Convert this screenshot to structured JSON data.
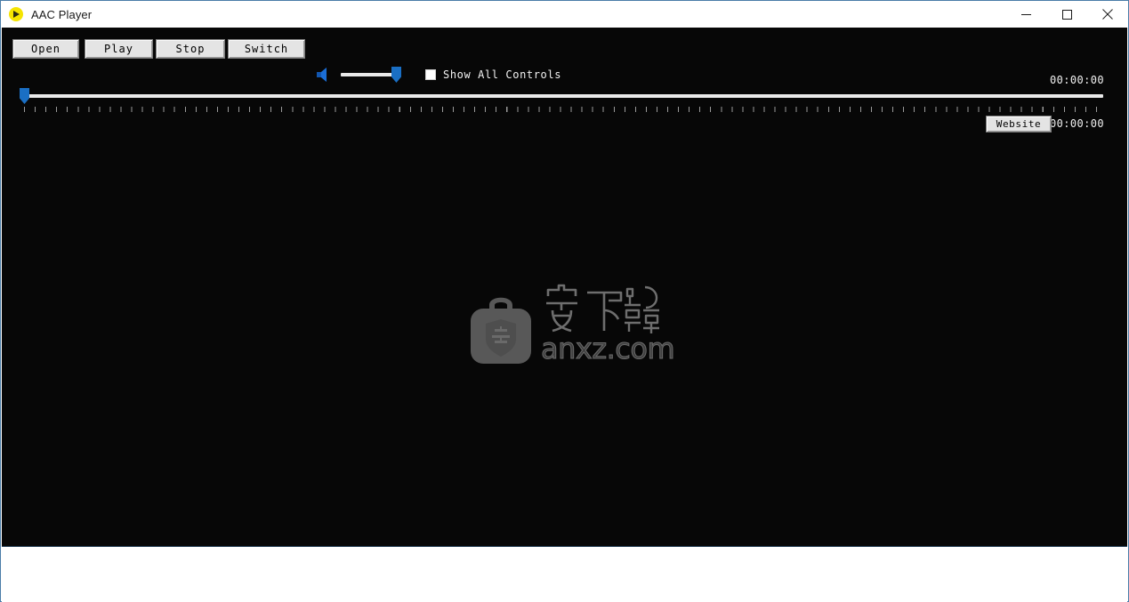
{
  "window": {
    "title": "AAC Player",
    "app_icon": "play-circle-icon",
    "controls": {
      "minimize": "minimize-icon",
      "maximize": "maximize-icon",
      "close": "close-icon"
    }
  },
  "toolbar": {
    "open_label": "Open",
    "play_label": "Play",
    "stop_label": "Stop",
    "switch_label": "Switch",
    "volume": {
      "icon": "speaker-icon",
      "value": 100,
      "min": 0,
      "max": 100
    },
    "show_all_controls": {
      "label": "Show All Controls",
      "checked": false
    }
  },
  "seek": {
    "value": 0,
    "min": 0,
    "max": 100,
    "elapsed_time": "00:00:00",
    "total_time": "00:00:00"
  },
  "website_button": {
    "label": "Website"
  },
  "watermark": {
    "brand_cn": "安下载",
    "brand_en": "anxz.com",
    "bag_icon": "shield-bag-icon",
    "shield_char": "安",
    "color": "#585858"
  },
  "statusbar": {
    "text": ""
  },
  "colors": {
    "accent": "#1a6fc4",
    "window_border": "#4a7ca8",
    "video_background": "#070707",
    "button_face": "#e4e4e4",
    "title_icon": "#f5e400"
  }
}
